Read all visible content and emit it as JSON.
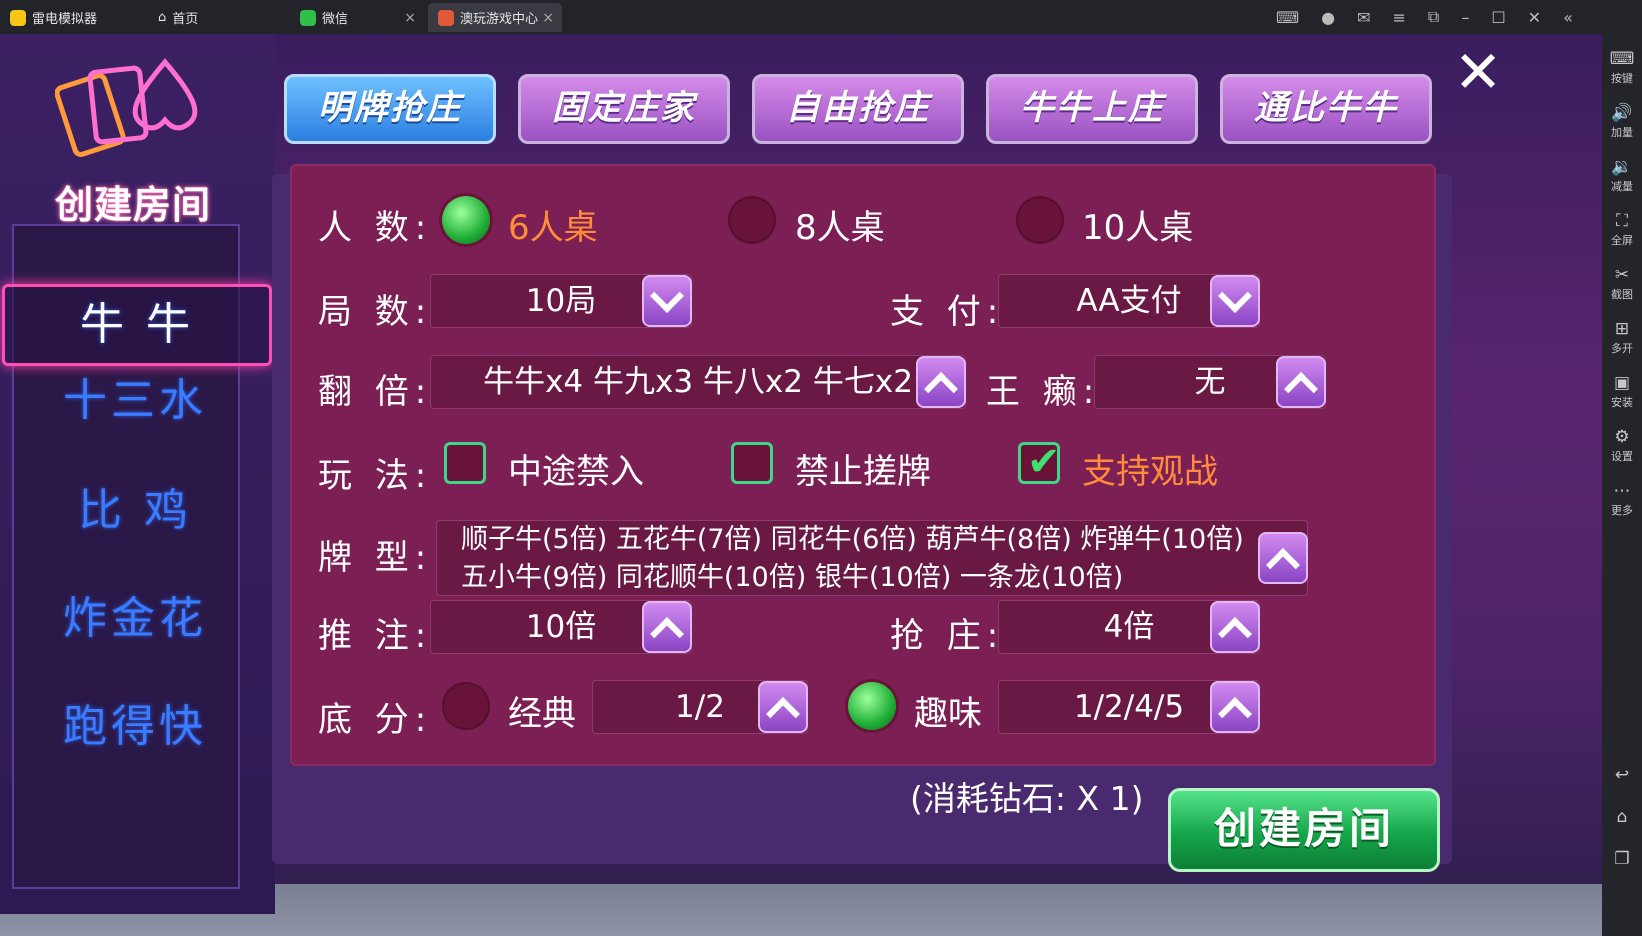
{
  "emulator": {
    "app_name": "雷电模拟器",
    "tabs": [
      {
        "label": "首页"
      },
      {
        "label": "微信"
      },
      {
        "label": "澳玩游戏中心"
      }
    ],
    "rail": [
      {
        "label": "按键",
        "icon": "keyboard-icon"
      },
      {
        "label": "加量",
        "icon": "volume-up-icon"
      },
      {
        "label": "减量",
        "icon": "volume-down-icon"
      },
      {
        "label": "全屏",
        "icon": "fullscreen-icon"
      },
      {
        "label": "截图",
        "icon": "screenshot-icon"
      },
      {
        "label": "多开",
        "icon": "multi-instance-icon"
      },
      {
        "label": "安装",
        "icon": "apk-install-icon"
      },
      {
        "label": "设置",
        "icon": "settings-icon"
      },
      {
        "label": "更多",
        "icon": "more-icon"
      }
    ]
  },
  "game": {
    "logo_title": "创建房间",
    "menu": [
      "牛 牛",
      "十三水",
      "比 鸡",
      "炸金花",
      "跑得快"
    ],
    "top_buttons": [
      "明牌抢庄",
      "固定庄家",
      "自由抢庄",
      "牛牛上庄",
      "通比牛牛"
    ],
    "players": {
      "label": "人  数:",
      "options": [
        "6人桌",
        "8人桌",
        "10人桌"
      ],
      "selected": "6人桌"
    },
    "rounds": {
      "label": "局  数:",
      "value": "10局"
    },
    "payment": {
      "label": "支  付:",
      "value": "AA支付"
    },
    "multiplier": {
      "label": "翻  倍:",
      "value": "牛牛x4 牛九x3 牛八x2 牛七x2"
    },
    "wild": {
      "label": "王  癞:",
      "value": "无"
    },
    "rules": {
      "label": "玩  法:",
      "items": [
        {
          "label": "中途禁入",
          "checked": false
        },
        {
          "label": "禁止搓牌",
          "checked": false
        },
        {
          "label": "支持观战",
          "checked": true
        }
      ]
    },
    "card_types": {
      "label": "牌  型:",
      "line1": "顺子牛(5倍) 五花牛(7倍) 同花牛(6倍) 葫芦牛(8倍) 炸弹牛(10倍)",
      "line2": "五小牛(9倍) 同花顺牛(10倍) 银牛(10倍) 一条龙(10倍)"
    },
    "push_bet": {
      "label": "推  注:",
      "value": "10倍"
    },
    "grab_banker": {
      "label": "抢  庄:",
      "value": "4倍"
    },
    "base_score": {
      "label": "底  分:",
      "classic": {
        "label": "经典",
        "value": "1/2",
        "selected": false
      },
      "fun": {
        "label": "趣味",
        "value": "1/2/4/5",
        "selected": true
      }
    },
    "cost_text": "(消耗钻石: X 1)",
    "create_button": "创建房间"
  }
}
